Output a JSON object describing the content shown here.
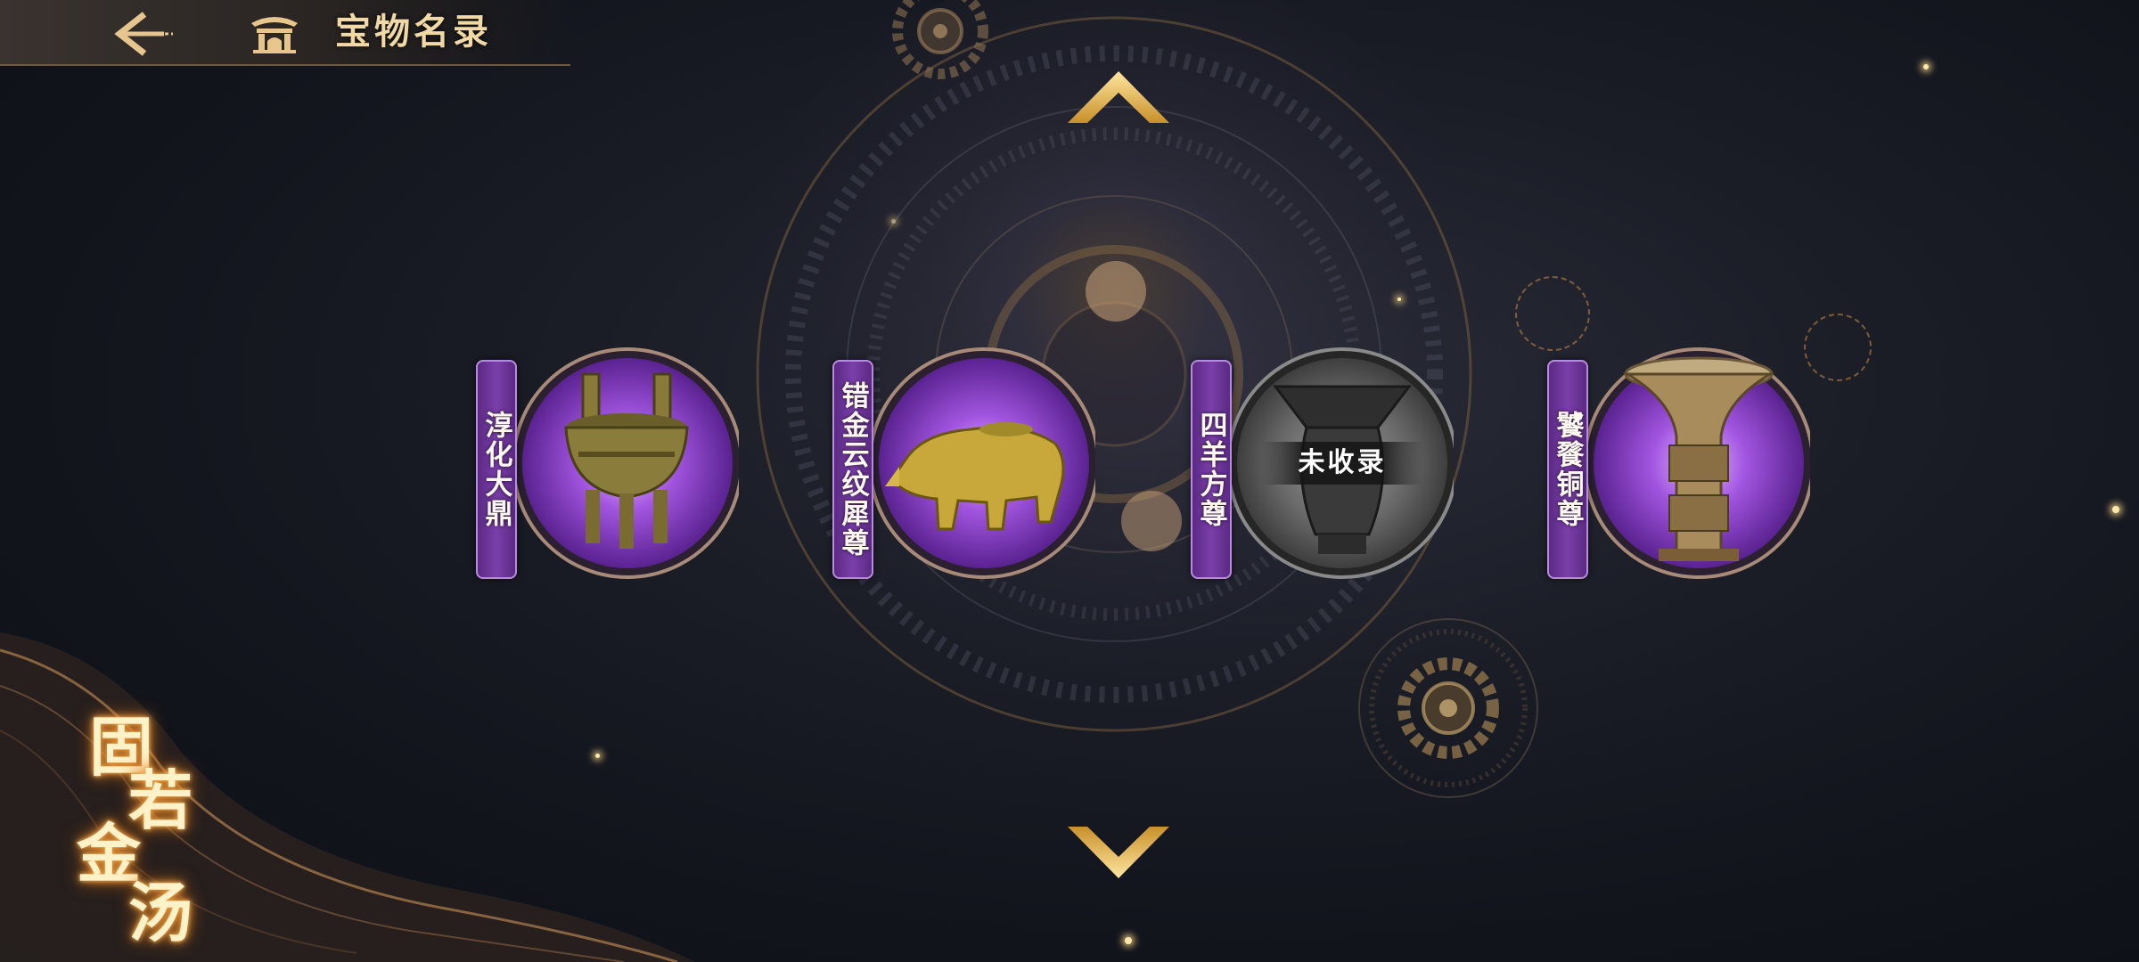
{
  "header": {
    "title": "宝物名录",
    "back_icon": "back-arrow-icon",
    "title_icon": "pavilion-icon"
  },
  "navigation": {
    "up_icon": "chevron-up-icon",
    "down_icon": "chevron-down-icon"
  },
  "treasures": [
    {
      "name": "淳化大鼎",
      "collected": true,
      "icon": "bronze-ding-icon"
    },
    {
      "name": "错金云纹犀尊",
      "collected": true,
      "icon": "rhinoceros-zun-icon"
    },
    {
      "name": "四羊方尊",
      "collected": false,
      "status": "未收录",
      "icon": "four-ram-zun-icon"
    },
    {
      "name": "饕餮铜尊",
      "collected": true,
      "icon": "taotie-bronze-zun-icon"
    }
  ],
  "slogan": {
    "chars": [
      "固",
      "若",
      "金",
      "汤"
    ]
  },
  "colors": {
    "accent_gold": "#e2b45a",
    "plate_purple": "#7b3fab",
    "medallion_purple": "#8a3fc4",
    "locked_gray": "#6a6a6a",
    "glow_orange": "#f0a040"
  }
}
